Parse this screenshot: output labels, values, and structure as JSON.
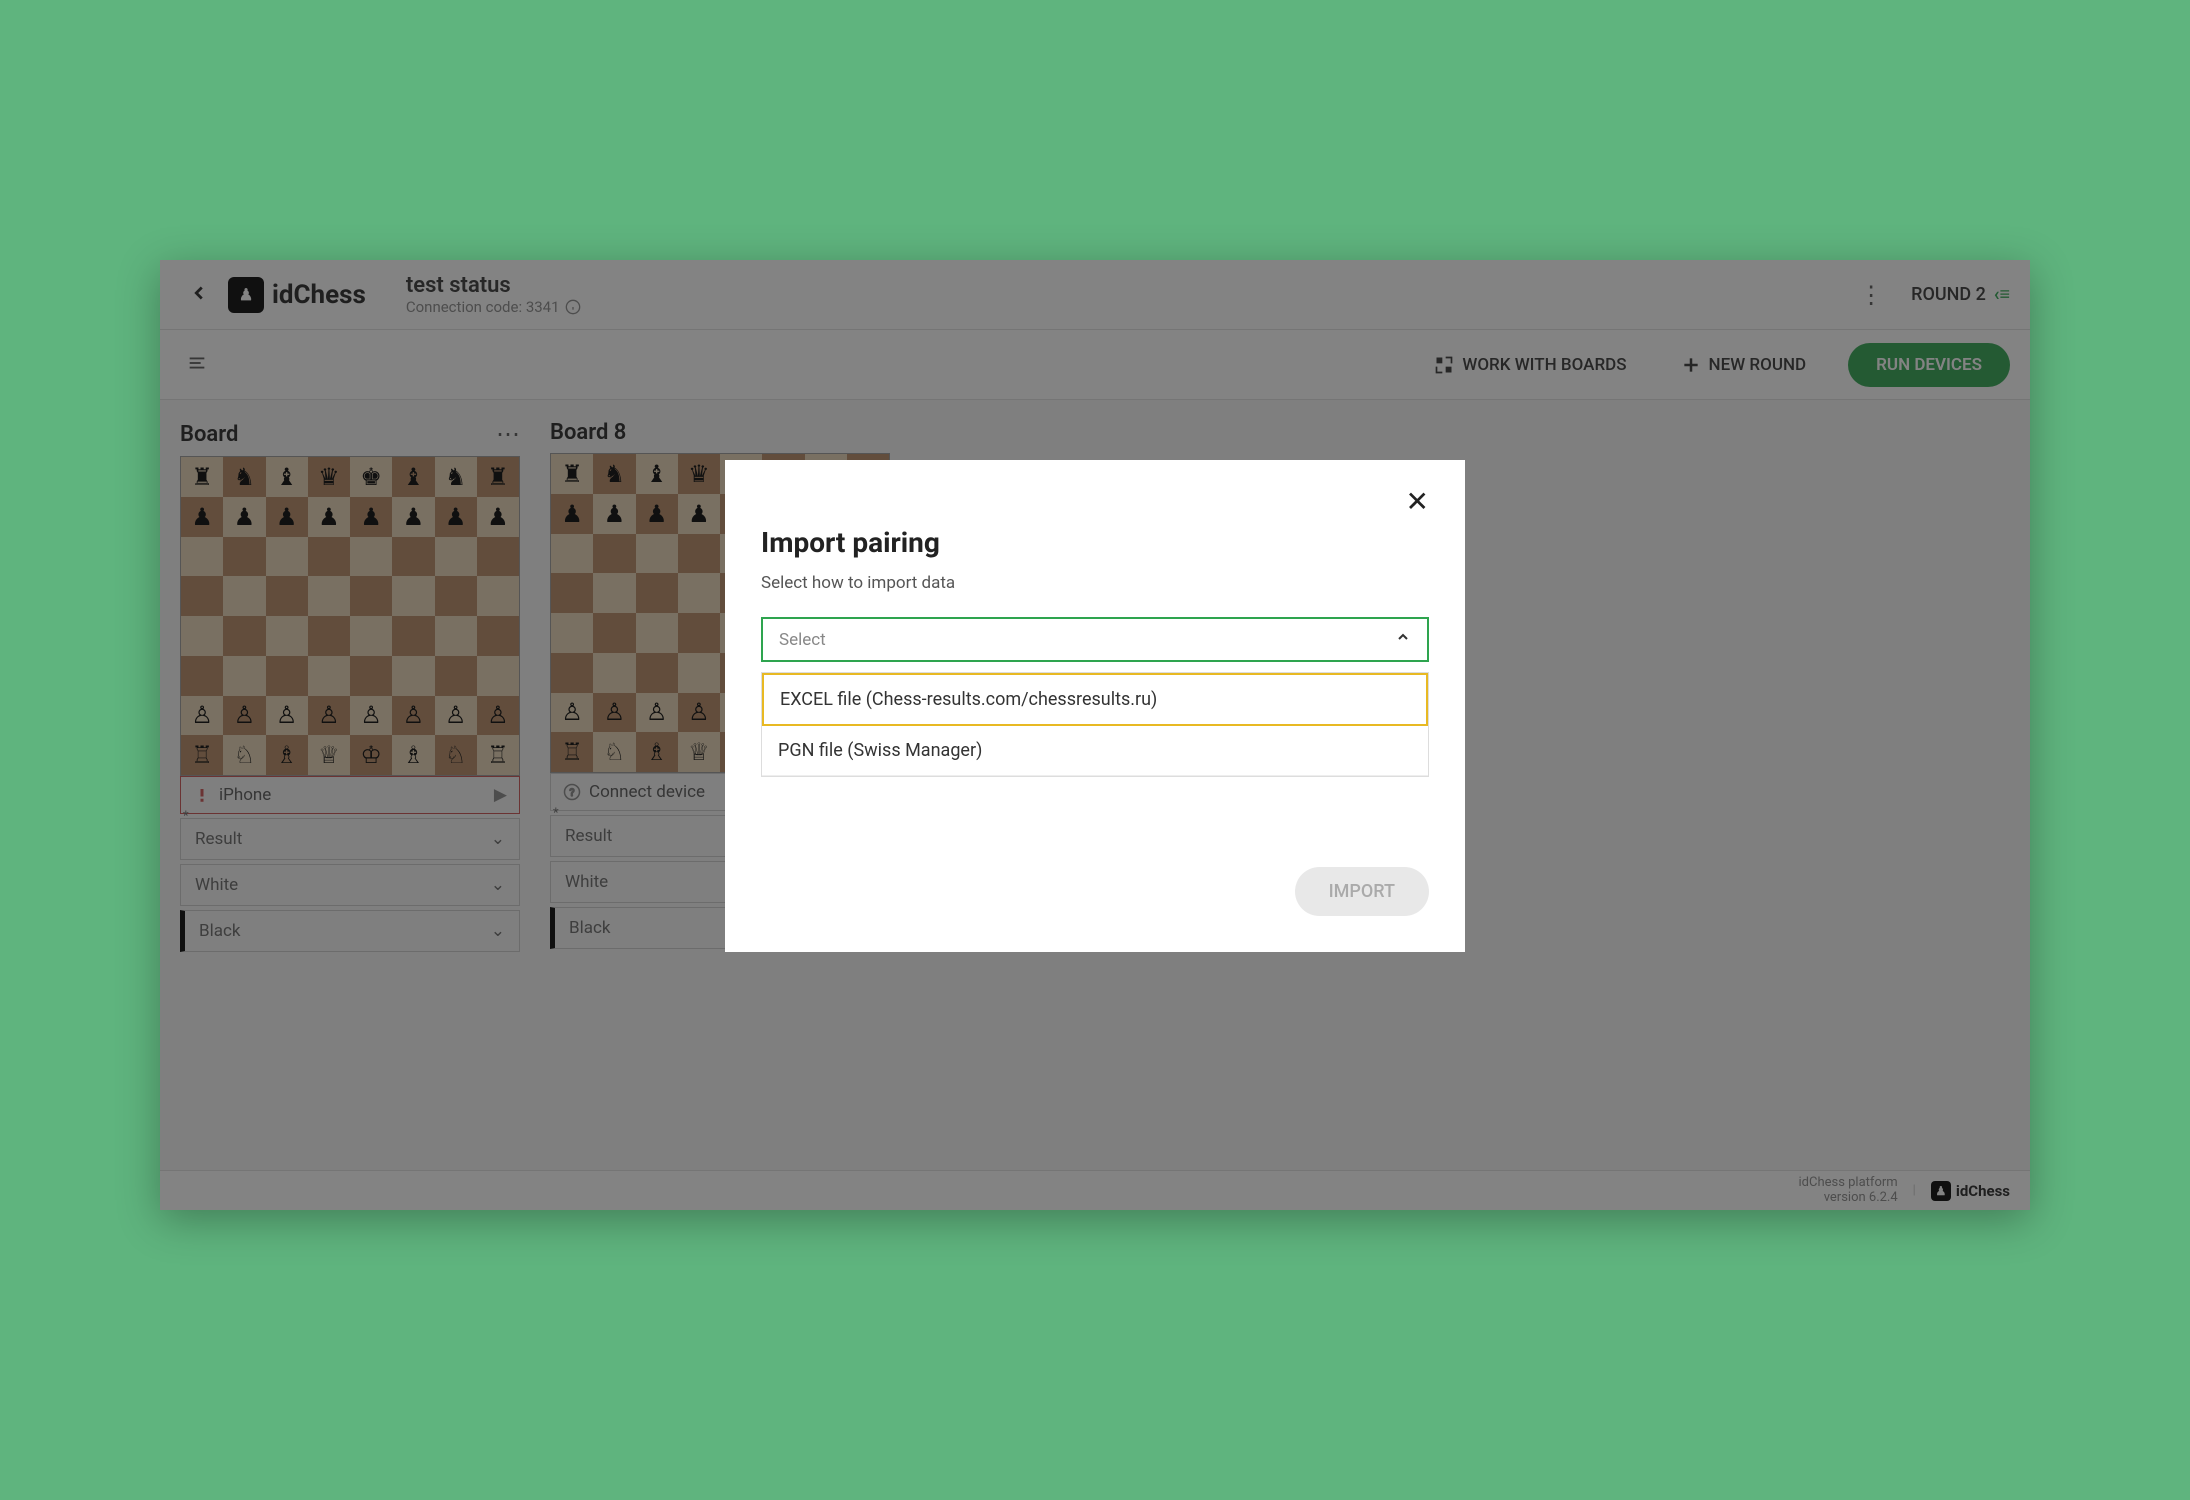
{
  "header": {
    "logo_text": "idChess",
    "title": "test status",
    "connection_label": "Connection code: 3341",
    "round_label": "ROUND 2"
  },
  "toolbar": {
    "work_with_boards": "WORK WITH BOARDS",
    "new_round": "NEW ROUND",
    "run_devices": "RUN DEVICES"
  },
  "boards": [
    {
      "title": "Board",
      "device": "iPhone",
      "result_label": "Result",
      "white_label": "White",
      "black_label": "Black",
      "device_alert": true
    },
    {
      "title": "Board 8",
      "device": "Connect device",
      "result_label": "Result",
      "white_label": "White",
      "black_label": "Black",
      "device_alert": false
    }
  ],
  "footer": {
    "platform_line": "idChess platform",
    "version_line": "version 6.2.4",
    "logo_text": "idChess"
  },
  "modal": {
    "title": "Import pairing",
    "subtitle": "Select how to import data",
    "select_placeholder": "Select",
    "options": [
      "EXCEL file (Chess-results.com/chessresults.ru)",
      "PGN file (Swiss Manager)"
    ],
    "import_label": "IMPORT"
  }
}
